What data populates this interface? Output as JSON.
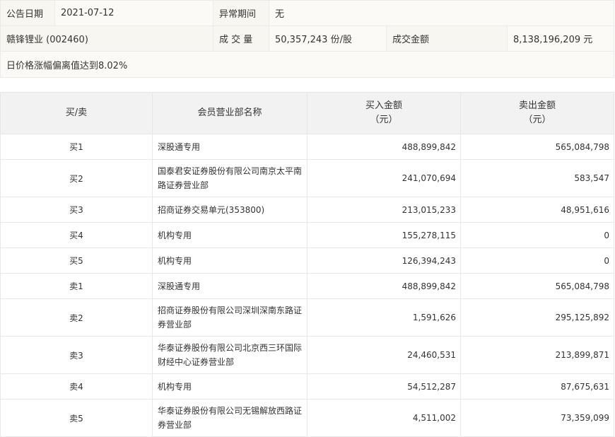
{
  "info": {
    "announce_label": "公告日期",
    "announce_date": "2021-07-12",
    "abnormal_label": "异常期间",
    "abnormal_value": "无",
    "stock": "赣锋锂业 (002460)",
    "volume_label": "成 交 量",
    "volume_value": "50,357,243 份/股",
    "amount_label": "成交金额",
    "amount_value": "8,138,196,209 元",
    "reason": "日价格涨幅偏离值达到8.02%"
  },
  "table": {
    "headers": {
      "side": "买/卖",
      "dept": "会员营业部名称",
      "buy_line1": "买入金额",
      "buy_line2": "（元）",
      "sell_line1": "卖出金额",
      "sell_line2": "（元）"
    },
    "rows": [
      {
        "side": "买1",
        "dept_l1": "深股通专用",
        "dept_l2": "",
        "buy": "488,899,842",
        "sell": "565,084,798"
      },
      {
        "side": "买2",
        "dept_l1": "国泰君安证券股份有限公司南京太平南",
        "dept_l2": "路证券营业部",
        "buy": "241,070,694",
        "sell": "583,547"
      },
      {
        "side": "买3",
        "dept_l1": "招商证券交易单元(353800)",
        "dept_l2": "",
        "buy": "213,015,233",
        "sell": "48,951,616"
      },
      {
        "side": "买4",
        "dept_l1": "机构专用",
        "dept_l2": "",
        "buy": "155,278,115",
        "sell": "0"
      },
      {
        "side": "买5",
        "dept_l1": "机构专用",
        "dept_l2": "",
        "buy": "126,394,243",
        "sell": "0"
      },
      {
        "side": "卖1",
        "dept_l1": "深股通专用",
        "dept_l2": "",
        "buy": "488,899,842",
        "sell": "565,084,798"
      },
      {
        "side": "卖2",
        "dept_l1": "招商证券股份有限公司深圳深南东路证",
        "dept_l2": "券营业部",
        "buy": "1,591,626",
        "sell": "295,125,892"
      },
      {
        "side": "卖3",
        "dept_l1": "华泰证券股份有限公司北京西三环国际",
        "dept_l2": "财经中心证券营业部",
        "buy": "24,460,531",
        "sell": "213,899,871"
      },
      {
        "side": "卖4",
        "dept_l1": "机构专用",
        "dept_l2": "",
        "buy": "54,512,287",
        "sell": "87,675,631"
      },
      {
        "side": "卖5",
        "dept_l1": "华泰证券股份有限公司无锡解放西路证",
        "dept_l2": "券营业部",
        "buy": "4,511,002",
        "sell": "73,359,099"
      }
    ]
  }
}
